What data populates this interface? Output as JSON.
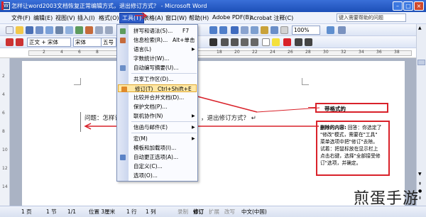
{
  "window": {
    "title": "怎样让word2003文档恢复正常编辑方式，退出修订方式？ - Microsoft Word",
    "app_icon": "W"
  },
  "menubar": {
    "items": [
      "文件(F)",
      "编辑(E)",
      "视图(V)",
      "插入(I)",
      "格式(O)",
      "工具(T)",
      "表格(A)",
      "窗口(W)",
      "帮助(H)",
      "Adobe PDF(B)",
      "Acrobat 注释(C)"
    ],
    "active_index": 5,
    "search_placeholder": "键入需要帮助的问题"
  },
  "format_toolbar": {
    "style_value": "正文 + 宋体",
    "font_value": "宋体",
    "size_value": "五号"
  },
  "tools_menu": {
    "items": [
      {
        "label": "拼写和语法(S)...",
        "shortcut": "F7",
        "submenu": false,
        "icon": "spelling-icon"
      },
      {
        "label": "信息检索(R)...",
        "shortcut": "Alt+单击",
        "submenu": false,
        "icon": "research-icon"
      },
      {
        "label": "语言(L)",
        "shortcut": "",
        "submenu": true,
        "icon": ""
      },
      {
        "label": "字数统计(W)...",
        "shortcut": "",
        "submenu": false,
        "icon": ""
      },
      {
        "label": "自动编写摘要(U)...",
        "shortcut": "",
        "submenu": false,
        "icon": "summary-icon"
      },
      {
        "label": "共享工作区(D)...",
        "shortcut": "",
        "submenu": false,
        "icon": ""
      },
      {
        "label": "修订(T)",
        "shortcut": "Ctrl+Shift+E",
        "submenu": false,
        "icon": "track-changes-icon",
        "highlighted": true
      },
      {
        "label": "比较并合并文档(D)...",
        "shortcut": "",
        "submenu": false,
        "icon": ""
      },
      {
        "label": "保护文档(P)...",
        "shortcut": "",
        "submenu": false,
        "icon": ""
      },
      {
        "label": "联机协作(N)",
        "shortcut": "",
        "submenu": true,
        "icon": ""
      },
      {
        "label": "信函与邮件(E)",
        "shortcut": "",
        "submenu": true,
        "icon": ""
      },
      {
        "label": "宏(M)",
        "shortcut": "",
        "submenu": true,
        "icon": ""
      },
      {
        "label": "模板和加载项(I)...",
        "shortcut": "",
        "submenu": false,
        "icon": ""
      },
      {
        "label": "自动更正选项(A)...",
        "shortcut": "",
        "submenu": false,
        "icon": "autocorrect-icon"
      },
      {
        "label": "自定义(C)...",
        "shortcut": "",
        "submenu": false,
        "icon": ""
      },
      {
        "label": "选项(O)...",
        "shortcut": "",
        "submenu": false,
        "icon": ""
      }
    ]
  },
  "document": {
    "body_text": "问题：怎样让",
    "body_text_end": "，退出修订方式？",
    "comment1": "带格式的",
    "comment2_title": "删除的内容:",
    "comment2_lines": [
      "回答：你选定了",
      "\"修改\"模式，需要在\"工具\"",
      "菜单选项中把\"修订\"去除。",
      "试着：把鼠标放在显示栏上",
      "点击右键，选择\"全部接受修",
      "订\"选项，并确定。"
    ]
  },
  "statusbar": {
    "page": "1 页",
    "section": "1 节",
    "page_of": "1/1",
    "position": "位置 3厘米",
    "line": "1 行",
    "column": "1 列",
    "rec": "录制",
    "trk": "修订",
    "ext": "扩展",
    "ovr": "改写",
    "lang": "中文(中国)"
  },
  "ruler_numbers": [
    "2",
    "4",
    "6",
    "8",
    "10",
    "12",
    "14",
    "16",
    "18",
    "20",
    "22",
    "24",
    "26",
    "28",
    "30",
    "32",
    "34",
    "36",
    "38",
    "40",
    "42"
  ],
  "watermark": "煎蛋手游",
  "colors": {
    "title_bar": "#1c4fb8",
    "menu_highlight": "#ffe8a6",
    "annotation_red": "#d9222a"
  }
}
